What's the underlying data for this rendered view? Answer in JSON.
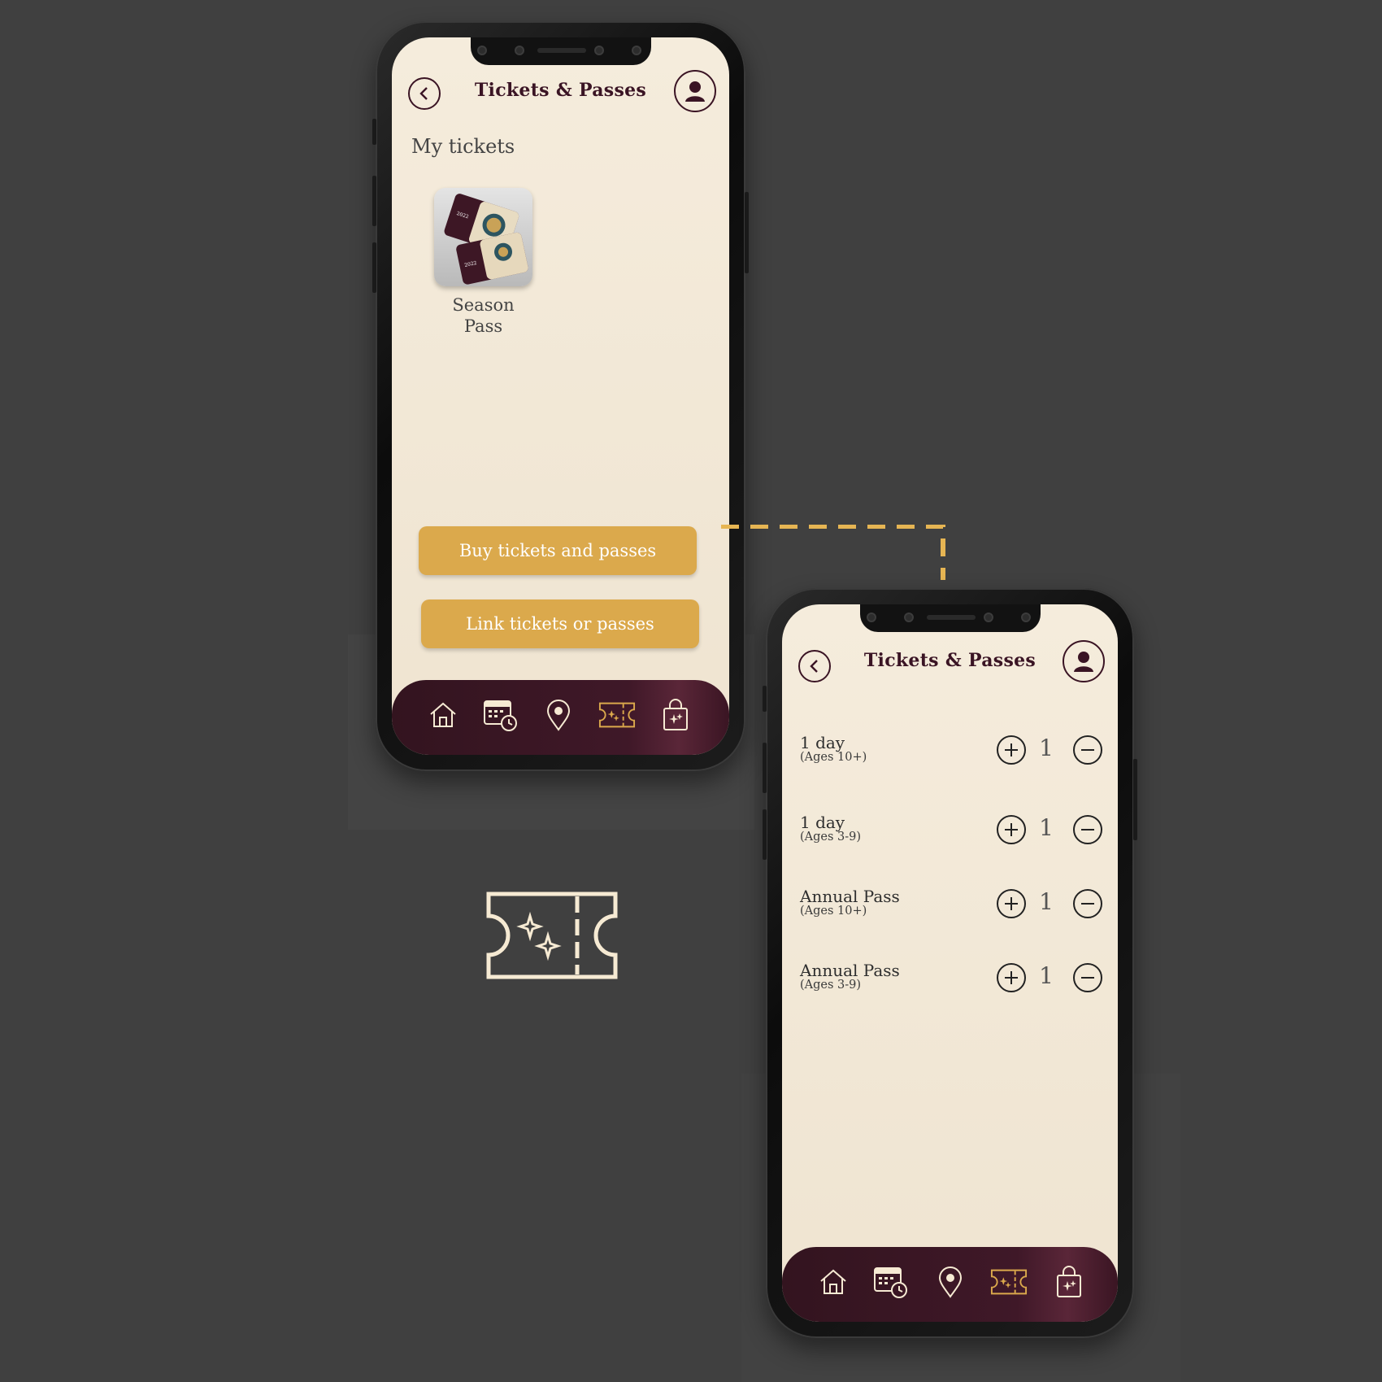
{
  "colors": {
    "background": "#404040",
    "screen": "#f3e9d8",
    "accent": "#dba94c",
    "maroon": "#3a1424",
    "icon_light": "#f6ead3"
  },
  "screen1": {
    "title": "Tickets & Passes",
    "section_title": "My tickets",
    "ticket_tile": {
      "label_line1": "Season",
      "label_line2": "Pass",
      "icon": "season-pass-image"
    },
    "buy_button": "Buy tickets and passes",
    "link_button": "Link tickets or passes",
    "tabs": [
      {
        "icon": "home-icon",
        "active": false
      },
      {
        "icon": "calendar-clock-icon",
        "active": false
      },
      {
        "icon": "location-pin-icon",
        "active": false
      },
      {
        "icon": "ticket-icon",
        "active": true
      },
      {
        "icon": "shopping-bag-icon",
        "active": false
      }
    ]
  },
  "screen2": {
    "title": "Tickets & Passes",
    "items": [
      {
        "name": "1 day",
        "age": "(Ages 10+)",
        "qty": "1"
      },
      {
        "name": "1 day",
        "age": "(Ages 3-9)",
        "qty": "1"
      },
      {
        "name": "Annual Pass",
        "age": "(Ages 10+)",
        "qty": "1"
      },
      {
        "name": "Annual Pass",
        "age": "(Ages 3-9)",
        "qty": "1"
      }
    ]
  },
  "featured_icon": "ticket-icon"
}
